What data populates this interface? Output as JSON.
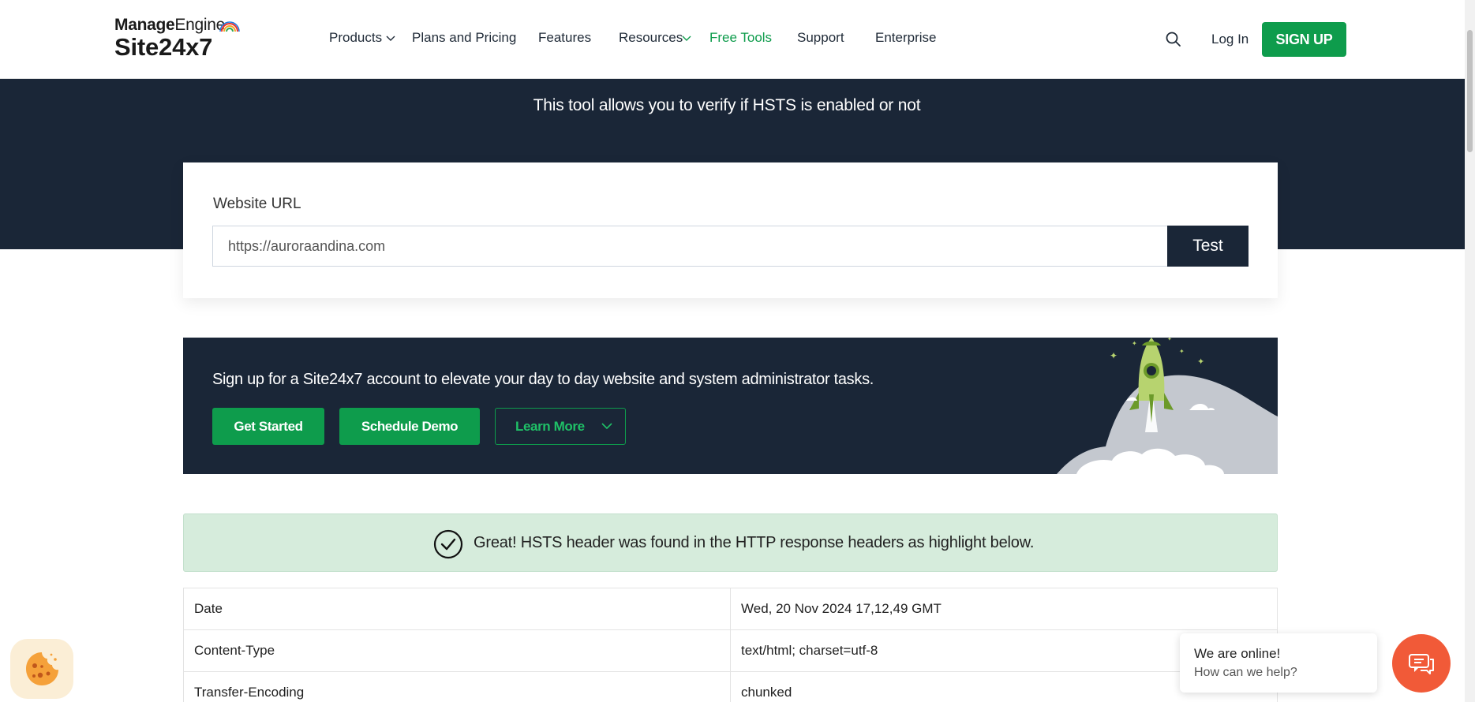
{
  "header": {
    "logo_brand_bold": "Manage",
    "logo_brand_light": "Engine",
    "logo_product": "Site24x7",
    "nav": [
      {
        "label": "Products",
        "has_dropdown": true
      },
      {
        "label": "Plans and Pricing",
        "has_dropdown": false
      },
      {
        "label": "Features",
        "has_dropdown": false
      },
      {
        "label": "Resources",
        "has_dropdown": true
      },
      {
        "label": "Free Tools",
        "has_dropdown": false,
        "active": true
      },
      {
        "label": "Support",
        "has_dropdown": false
      },
      {
        "label": "Enterprise",
        "has_dropdown": false
      }
    ],
    "login_label": "Log In",
    "signup_label": "SIGN UP"
  },
  "hero": {
    "description": "This tool allows you to verify if HSTS is enabled or not"
  },
  "form": {
    "label": "Website URL",
    "url_value": "https://auroraandina.com",
    "test_label": "Test"
  },
  "banner": {
    "text": "Sign up for a Site24x7 account to elevate your day to day website and system administrator tasks.",
    "get_started_label": "Get Started",
    "schedule_demo_label": "Schedule Demo",
    "learn_more_label": "Learn More"
  },
  "result": {
    "message": "Great! HSTS header was found in the HTTP response headers as highlight below."
  },
  "headers_table": [
    {
      "name": "Date",
      "value": "Wed, 20 Nov 2024 17,12,49 GMT"
    },
    {
      "name": "Content-Type",
      "value": "text/html; charset=utf-8"
    },
    {
      "name": "Transfer-Encoding",
      "value": "chunked"
    }
  ],
  "chat": {
    "title": "We are online!",
    "subtitle": "How can we help?"
  },
  "colors": {
    "brand_green": "#0e9c4c",
    "dark_navy": "#1a2637",
    "success_bg": "#d6ecdc",
    "chat_orange": "#f15a38"
  },
  "icons": {
    "search": "search-icon",
    "chevron": "chevron-down-icon",
    "success": "check-circle-icon",
    "cookie": "cookie-icon",
    "chat": "chat-icon",
    "illustration": "rocket-illustration"
  }
}
